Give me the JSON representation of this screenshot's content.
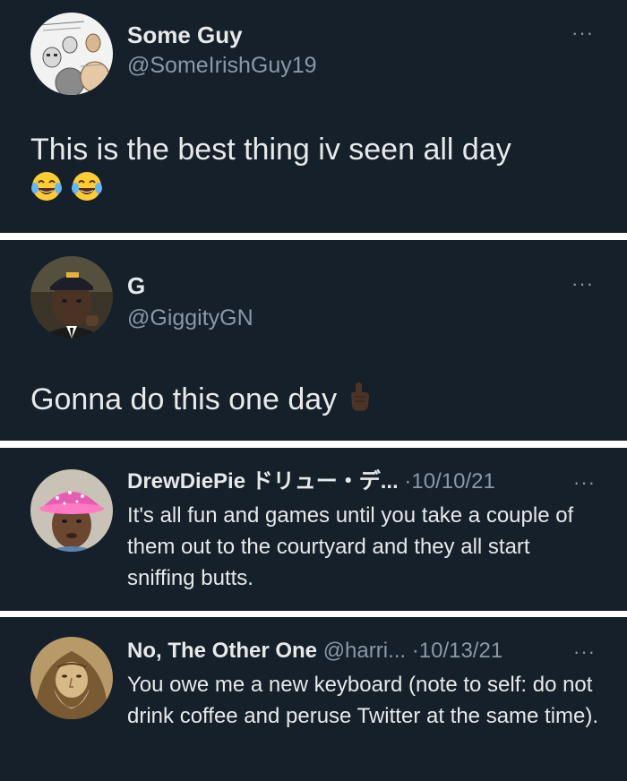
{
  "tweets": [
    {
      "display_name": "Some Guy",
      "handle": "@SomeIrishGuy19",
      "text": "This is the best thing iv seen all day",
      "emoji": [
        "laughing-tears",
        "laughing-tears"
      ],
      "more_icon": "ellipsis-icon"
    },
    {
      "display_name": "G",
      "handle": "@GiggityGN",
      "text": "Gonna do this one day",
      "emoji": [
        "point-up-dark"
      ],
      "more_icon": "ellipsis-icon"
    }
  ],
  "replies": [
    {
      "display_name": "DrewDiePie ドリュー・デ...",
      "separator": "·",
      "date": "10/10/21",
      "text": "It's all fun and games until you take a couple of them out to the courtyard and they all start sniffing butts."
    },
    {
      "display_name": "No, The Other One",
      "handle": "@harri...",
      "separator": "·",
      "date": "10/13/21",
      "text": "You owe me a new keyboard (note to self: do not drink coffee and peruse Twitter at the same time)."
    }
  ],
  "more_label": "···",
  "colors": {
    "background": "#15202b",
    "text": "#e7e9ea",
    "muted": "#8b98a5",
    "divider": "#ffffff"
  }
}
